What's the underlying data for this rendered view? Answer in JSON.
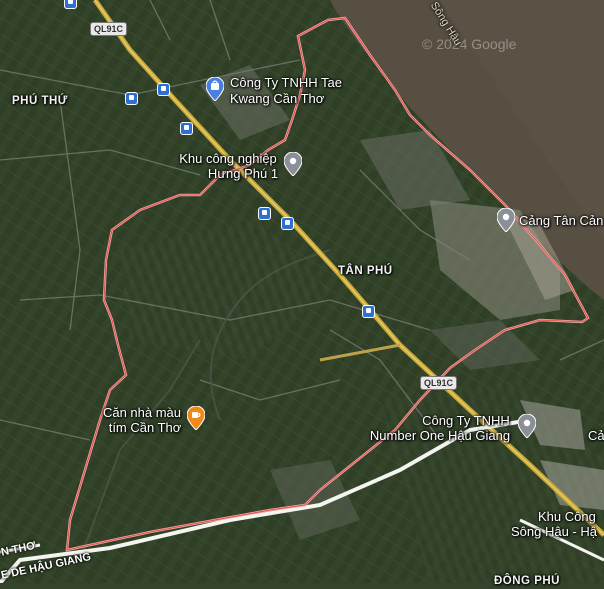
{
  "map": {
    "water_color": "#574f41",
    "land_color": "#33432b",
    "boundary_color": "#f08a8a",
    "highway_color": "#c9a83a"
  },
  "watermark": "© 2024 Google",
  "river_label": "Sông Hậu",
  "highways": {
    "main": "QL91C",
    "lower": "QL91C"
  },
  "areas": {
    "phu_thu": "PHÚ THỨ",
    "tan_phu": "TÂN PHÚ",
    "dong_phu": "ĐÔNG PHÚ"
  },
  "places": {
    "tae_kwang_line1": "Công Ty TNHH Tae",
    "tae_kwang_line2": "Kwang Cần Thơ",
    "kcn_hung_phu_line1": "Khu công nghiệp",
    "kcn_hung_phu_line2": "Hưng Phú 1",
    "cang_tan_cang": "Cảng Tân Cản",
    "can_nha_line1": "Căn nhà màu",
    "can_nha_line2": "tím Cần Thơ",
    "number_one_line1": "Công Ty TNHH",
    "number_one_line2": "Number One Hậu Giang",
    "edge_c": "Cả",
    "kcn_song_hau_line1": "Khu Công",
    "kcn_song_hau_line2": "Sông Hậu - Hậ"
  },
  "border_road_labels": {
    "line1": "N THƠ",
    "line2": "E DE HẬU GIANG"
  },
  "icons": [
    "shopping-pin-icon",
    "place-pin-icon",
    "cafe-pin-icon",
    "bus-stop-icon"
  ]
}
